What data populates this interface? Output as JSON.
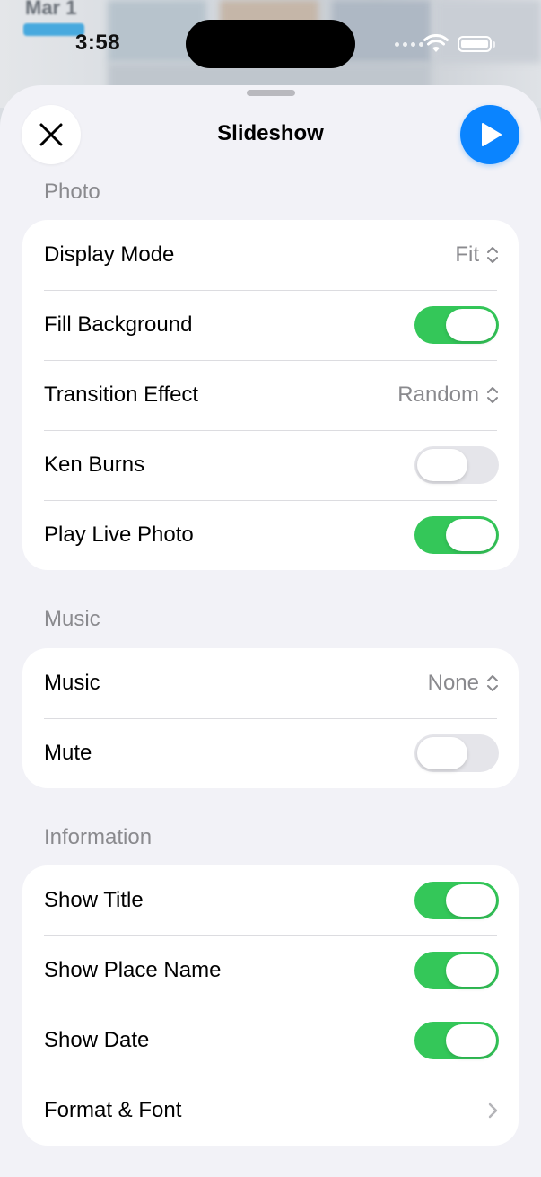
{
  "status_bar": {
    "time": "3:58"
  },
  "background": {
    "date_label": "Mar 1"
  },
  "sheet": {
    "title": "Slideshow",
    "close_icon": "xmark-icon",
    "play_icon": "play-icon"
  },
  "sections": {
    "photo": {
      "header": "Photo",
      "display_mode": {
        "label": "Display Mode",
        "value": "Fit"
      },
      "fill_background": {
        "label": "Fill Background",
        "on": true
      },
      "transition_effect": {
        "label": "Transition Effect",
        "value": "Random"
      },
      "ken_burns": {
        "label": "Ken Burns",
        "on": false
      },
      "play_live_photo": {
        "label": "Play Live Photo",
        "on": true
      }
    },
    "music": {
      "header": "Music",
      "music": {
        "label": "Music",
        "value": "None"
      },
      "mute": {
        "label": "Mute",
        "on": false
      }
    },
    "information": {
      "header": "Information",
      "show_title": {
        "label": "Show Title",
        "on": true
      },
      "show_place_name": {
        "label": "Show Place Name",
        "on": true
      },
      "show_date": {
        "label": "Show Date",
        "on": true
      },
      "format_font": {
        "label": "Format & Font"
      }
    }
  },
  "colors": {
    "accent": "#0a84ff",
    "toggle_on": "#34c759",
    "toggle_off": "#e5e5ea",
    "secondary_text": "#8a8a8e"
  }
}
